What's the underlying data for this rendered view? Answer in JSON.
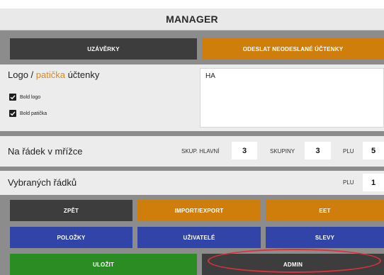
{
  "window": {
    "title": "MANAGER"
  },
  "top_buttons": {
    "closings": "UZÁVĚRKY",
    "send_unsent": "ODESLAT NEODESLANÉ ÚČTENKY"
  },
  "receipt": {
    "label_part1": "Logo / ",
    "label_part2": "patička",
    "label_part3": " účtenky",
    "bold_logo": "Bold logo",
    "bold_footer": "Bold patička",
    "text_value": "HA"
  },
  "grid_row": {
    "label": "Na řádek v mřížce",
    "main_groups_label": "SKUP. HLAVNÍ",
    "main_groups_value": "3",
    "groups_label": "SKUPINY",
    "groups_value": "3",
    "plu_label": "PLU",
    "plu_value": "5"
  },
  "selected_rows": {
    "label": "Vybraných řádků",
    "plu_label": "PLU",
    "plu_value": "1"
  },
  "buttons": {
    "back": "ZPĚT",
    "import_export": "IMPORT/EXPORT",
    "eet": "EET",
    "items": "POLOŽKY",
    "users": "UŽIVATELÉ",
    "discounts": "SLEVY",
    "save": "ULOŽIT",
    "admin": "ADMIN"
  },
  "colors": {
    "dark": "#3d3d3d",
    "orange": "#d07e0b",
    "blue": "#3145a8",
    "green": "#2a8c23",
    "highlight": "#e0303a",
    "accent_text": "#d88a22"
  }
}
